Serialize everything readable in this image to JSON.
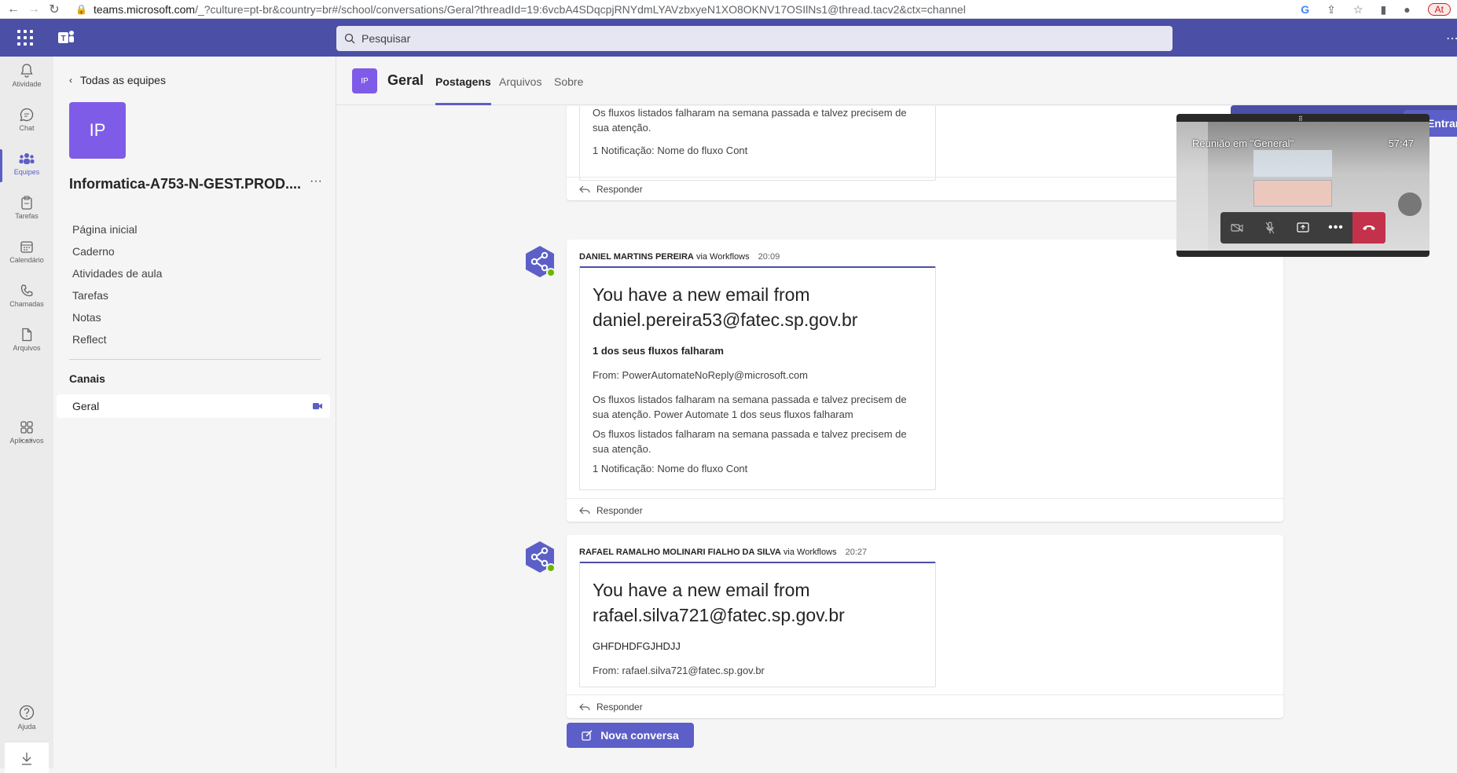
{
  "browser": {
    "url_host": "teams.microsoft.com",
    "url_path": "/_?culture=pt-br&country=br#/school/conversations/Geral?threadId=19:6vcbA4SDqcpjRNYdmLYAVzbxyeN1XO8OKNV17OSIlNs1@thread.tacv2&ctx=channel",
    "profile_label": "At"
  },
  "topbar": {
    "search_placeholder": "Pesquisar"
  },
  "rail": {
    "items": [
      {
        "label": "Atividade",
        "icon": "bell-icon"
      },
      {
        "label": "Chat",
        "icon": "chat-icon"
      },
      {
        "label": "Equipes",
        "icon": "teams-icon"
      },
      {
        "label": "Tarefas",
        "icon": "assignments-icon"
      },
      {
        "label": "Calendário",
        "icon": "calendar-icon"
      },
      {
        "label": "Chamadas",
        "icon": "phone-icon"
      },
      {
        "label": "Arquivos",
        "icon": "file-icon"
      },
      {
        "label": "Aplicativos",
        "icon": "apps-icon"
      },
      {
        "label": "Ajuda",
        "icon": "help-icon"
      }
    ],
    "more": "···"
  },
  "team": {
    "back_label": "Todas as equipes",
    "avatar": "IP",
    "name": "Informatica-A753-N-GEST.PROD....",
    "nav": [
      "Página inicial",
      "Caderno",
      "Atividades de aula",
      "Tarefas",
      "Notas",
      "Reflect"
    ],
    "channels_header": "Canais",
    "channel": "Geral"
  },
  "channel_header": {
    "avatar": "IP",
    "title": "Geral",
    "tabs": [
      "Postagens",
      "Arquivos",
      "Sobre"
    ]
  },
  "posts": [
    {
      "lines": [
        "Os fluxos listados falharam na semana passada e talvez precisem de sua atenção.",
        "1 Notificação: Nome do fluxo Cont"
      ],
      "reply": "Responder"
    },
    {
      "author": "DANIEL MARTINS PEREIRA",
      "via": "via Workflows",
      "time": "20:09",
      "heading": "You have a new email from daniel.pereira53@fatec.sp.gov.br",
      "subject": "1 dos seus fluxos falharam",
      "from": "From: PowerAutomateNoReply@microsoft.com",
      "body1": "Os fluxos listados falharam na semana passada e talvez precisem de sua atenção. Power Automate 1 dos seus fluxos falharam",
      "body2": "Os fluxos listados falharam na semana passada e talvez precisem de sua atenção.",
      "body3": "1 Notificação: Nome do fluxo Cont",
      "reply": "Responder"
    },
    {
      "author": "RAFAEL RAMALHO MOLINARI FIALHO DA SILVA",
      "via": "via Workflows",
      "time": "20:27",
      "heading": "You have a new email from rafael.silva721@fatec.sp.gov.br",
      "subject": "GHFDHDFGJHDJJ",
      "from": "From: rafael.silva721@fatec.sp.gov.br",
      "reply": "Responder"
    }
  ],
  "new_conversation": "Nova conversa",
  "meeting": {
    "title": "Reunião em \"General\"",
    "timer": "57:47",
    "join": "Entrar"
  },
  "colors": {
    "brand": "#4b4fa6",
    "accent": "#5b5fc7",
    "hangup": "#c4314b",
    "presence": "#6bb700"
  }
}
